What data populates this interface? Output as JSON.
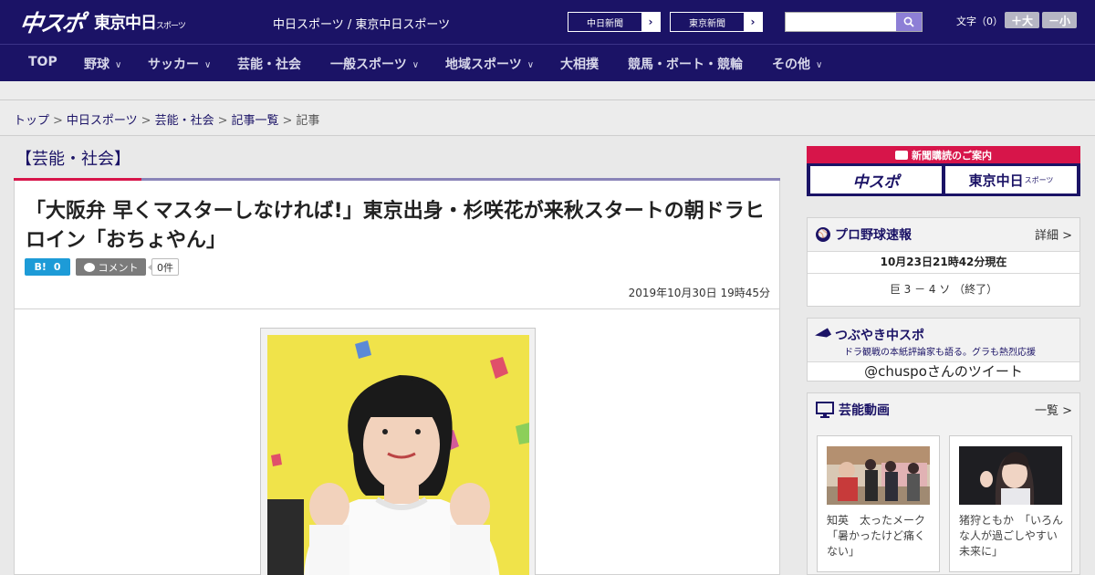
{
  "header": {
    "logo_main": "中スポ",
    "logo_tokyo": "東京中日",
    "logo_tokyo_suffix": "スポーツ",
    "site_name": "中日スポーツ / 東京中日スポーツ",
    "ext_links": [
      "中日新聞",
      "東京新聞"
    ],
    "search": {
      "value": "",
      "placeholder": ""
    },
    "font_size_label": "文字（0）",
    "font_bigger": "＋大",
    "font_smaller": "－小"
  },
  "nav": {
    "items": [
      {
        "label": "TOP",
        "has_dropdown": false
      },
      {
        "label": "野球",
        "has_dropdown": true
      },
      {
        "label": "サッカー",
        "has_dropdown": true
      },
      {
        "label": "芸能・社会",
        "has_dropdown": false
      },
      {
        "label": "一般スポーツ",
        "has_dropdown": true
      },
      {
        "label": "地域スポーツ",
        "has_dropdown": true
      },
      {
        "label": "大相撲",
        "has_dropdown": false
      },
      {
        "label": "競馬・ボート・競輪",
        "has_dropdown": false
      },
      {
        "label": "その他",
        "has_dropdown": true
      }
    ]
  },
  "breadcrumb": {
    "links": [
      "トップ",
      "中日スポーツ",
      "芸能・社会",
      "記事一覧"
    ],
    "current": "記事",
    "separator": ">"
  },
  "article": {
    "section": "【芸能・社会】",
    "headline": "「大阪弁 早くマスターしなければ!」東京出身・杉咲花が来秋スタートの朝ドラヒロイン「おちょやん」",
    "hatena_label": "B!",
    "hatena_count": "0",
    "comment_label": "コメント",
    "comment_count": "0件",
    "date": "2019年10月30日 19時45分"
  },
  "sidebar": {
    "subscribe": {
      "title": "新聞購読のご案内",
      "buttons": [
        "中スポ",
        "東京中日"
      ],
      "button_suffix": "スポーツ"
    },
    "baseball": {
      "title": "プロ野球速報",
      "more": "詳細 >",
      "updated": "10月23日21時42分現在",
      "result": "巨 3 － 4 ソ （終了）"
    },
    "tweets": {
      "title": "つぶやき中スポ",
      "subtitle": "ドラ観戦の本紙評論家も語る。グラも熱烈応援",
      "link": "@chuspoさんのツイート"
    },
    "videos": {
      "title": "芸能動画",
      "more": "一覧 >",
      "items": [
        {
          "caption": "知英　太ったメーク「暑かったけど痛くない」"
        },
        {
          "caption": "猪狩ともか　「いろんな人が過ごしやすい未来に」"
        }
      ]
    }
  },
  "colors": {
    "brand_navy": "#1b1366",
    "accent_red": "#d7154a",
    "hatena_blue": "#1d9bd7"
  }
}
